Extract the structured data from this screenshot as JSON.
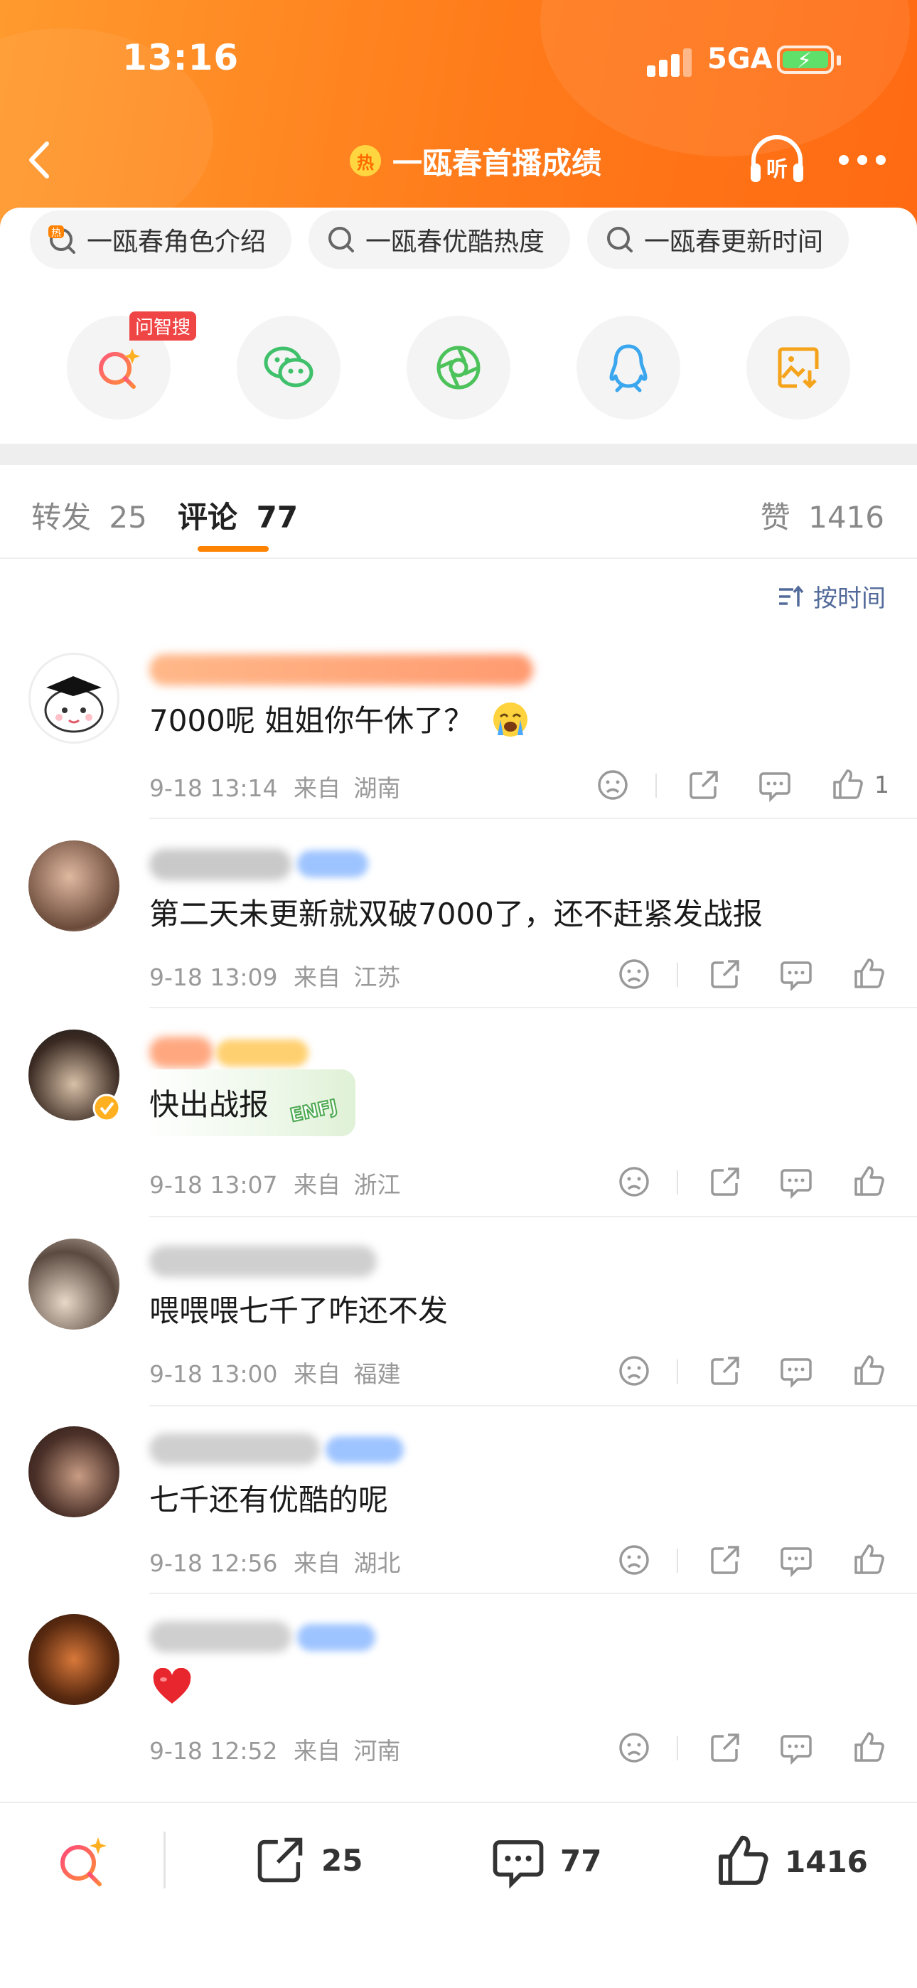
{
  "status_bar": {
    "time": "13:16",
    "network": "5GA"
  },
  "header": {
    "title": "一瓯春首播成绩",
    "hot_badge": "热"
  },
  "search_chips": [
    {
      "label": "一瓯春角色介绍"
    },
    {
      "label": "一瓯春优酷热度"
    },
    {
      "label": "一瓯春更新时间"
    }
  ],
  "share": {
    "wenzhisou_badge": "问智搜"
  },
  "tabs": {
    "repost_label": "转发",
    "repost_count": "25",
    "comment_label": "评论",
    "comment_count": "77",
    "like_label": "赞",
    "like_count": "1416"
  },
  "sort_label": "按时间",
  "comments": [
    {
      "text": "7000呢 姐姐你午休了？",
      "time": "9-18 13:14",
      "from": "来自",
      "location": "湖南",
      "likes": "1"
    },
    {
      "text": "第二天未更新就双破7000了，还不赶紧发战报",
      "time": "9-18 13:09",
      "from": "来自",
      "location": "江苏",
      "likes": ""
    },
    {
      "text": "快出战报",
      "time": "9-18 13:07",
      "from": "来自",
      "location": "浙江",
      "likes": ""
    },
    {
      "text": "喂喂喂七千了咋还不发",
      "time": "9-18 13:00",
      "from": "来自",
      "location": "福建",
      "likes": ""
    },
    {
      "text": "七千还有优酷的呢",
      "time": "9-18 12:56",
      "from": "来自",
      "location": "湖北",
      "likes": ""
    },
    {
      "text": "",
      "time": "9-18 12:52",
      "from": "来自",
      "location": "河南",
      "likes": ""
    }
  ],
  "bottom_bar": {
    "repost_count": "25",
    "comment_count": "77",
    "like_count": "1416"
  },
  "colors": {
    "accent_orange": "#ff8200",
    "header_orange": "#ff7a1a",
    "sort_blue": "#536b9a"
  }
}
